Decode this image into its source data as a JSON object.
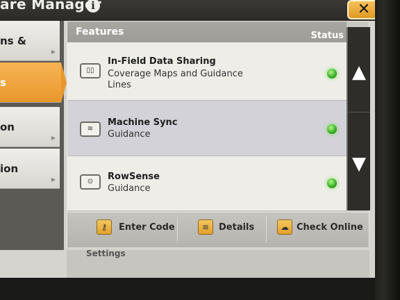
{
  "window": {
    "title": "are Manager",
    "close_label": "✕"
  },
  "sidebar": {
    "items": [
      {
        "label": "ns &"
      },
      {
        "label": "s"
      },
      {
        "label": "on"
      },
      {
        "label": "ion"
      }
    ]
  },
  "panel": {
    "header": {
      "features": "Features",
      "status": "Status"
    },
    "rows": [
      {
        "name": "In-Field Data Sharing",
        "desc": "Coverage Maps and Guidance Lines",
        "icon": "data-sharing-icon",
        "status": "active",
        "status_color": "#3ab22a"
      },
      {
        "name": "Machine Sync",
        "desc": "Guidance",
        "icon": "machine-sync-icon",
        "status": "active",
        "status_color": "#3ab22a"
      },
      {
        "name": "RowSense",
        "desc": "Guidance",
        "icon": "rowsense-icon",
        "status": "active",
        "status_color": "#3ab22a"
      }
    ],
    "scroll": {
      "up": "▲",
      "down": "▼"
    }
  },
  "actions": {
    "enter_code": "Enter Code",
    "details": "Details",
    "check_online": "Check Online"
  },
  "below": {
    "text": "Settings"
  },
  "colors": {
    "accent": "#e9972c",
    "header": "#a8a7a1",
    "status_led": "#3ab22a"
  }
}
